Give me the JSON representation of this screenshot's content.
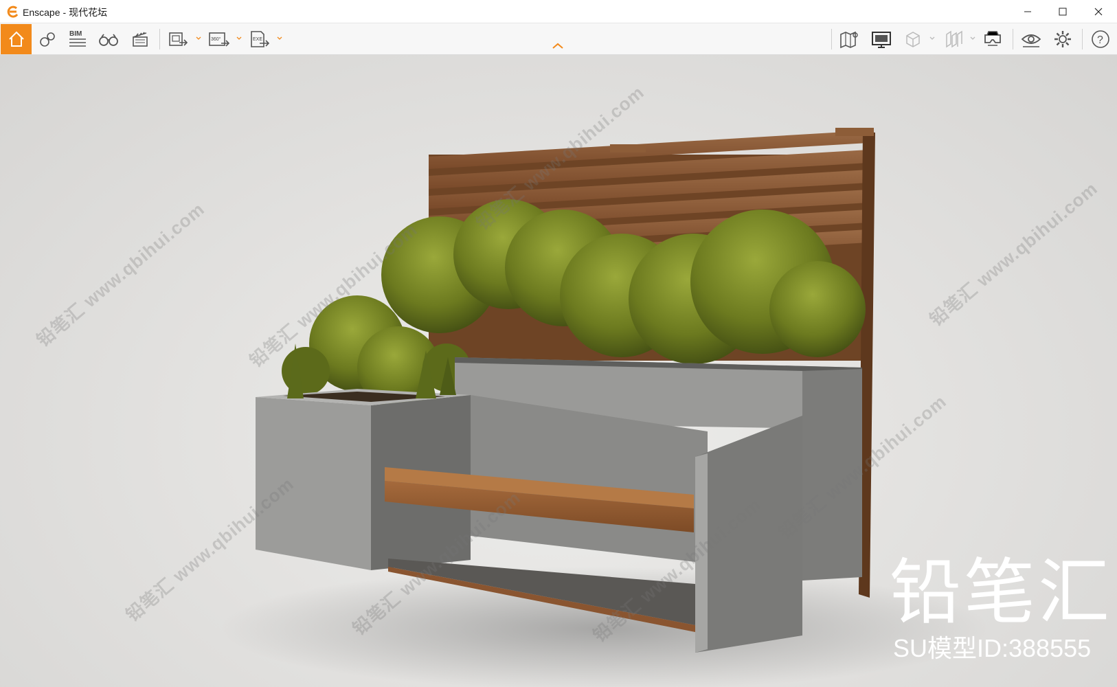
{
  "window": {
    "app_name": "Enscape",
    "separator": "-",
    "document_name": "现代花坛"
  },
  "toolbar": {
    "items": [
      {
        "icon": "home-icon",
        "active": true
      },
      {
        "icon": "asset-library-icon"
      },
      {
        "icon": "bim-icon",
        "label": "BIM"
      },
      {
        "icon": "binoculars-icon"
      },
      {
        "icon": "clapperboard-icon"
      },
      {
        "icon": "screenshot-export-icon"
      },
      {
        "icon": "panorama-360-export-icon",
        "label": "360°"
      },
      {
        "icon": "exe-export-icon",
        "label": "EXE"
      },
      {
        "icon": "map-icon"
      },
      {
        "icon": "monitor-icon"
      },
      {
        "icon": "cube-view-icon"
      },
      {
        "icon": "section-icon"
      },
      {
        "icon": "vr-headset-icon"
      },
      {
        "icon": "eye-icon"
      },
      {
        "icon": "settings-gear-icon"
      },
      {
        "icon": "help-icon",
        "label": "?"
      }
    ]
  },
  "watermark": {
    "brand": "铅笔汇",
    "model_id": "SU模型ID:388555",
    "repeat_cn": "铅笔汇",
    "repeat_url": "www.qbihui.com"
  },
  "colors": {
    "accent": "#f28a1b",
    "wood": "#8a5530",
    "concrete": "#8d8d8d",
    "foliage": "#6d7c1e"
  }
}
